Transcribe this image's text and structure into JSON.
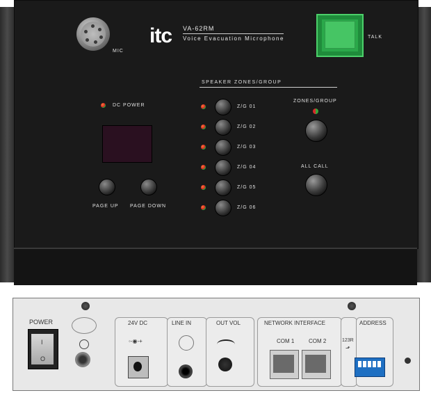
{
  "front": {
    "brand": "itc",
    "model": "VA-62RM",
    "description": "Voice Evacuation Microphone",
    "mic_label": "MIC",
    "talk_label": "TALK",
    "speaker_zones_title": "SPEAKER ZONES/GROUP",
    "power_label": "DC POWER",
    "page_up_label": "PAGE UP",
    "page_down_label": "PAGE DOWN",
    "zones": [
      "Z/G 01",
      "Z/G 02",
      "Z/G 03",
      "Z/G 04",
      "Z/G 05",
      "Z/G 06"
    ],
    "zones_group_label": "ZONES/GROUP",
    "all_call_label": "ALL CALL"
  },
  "back": {
    "power_label": "POWER",
    "power_on": "I",
    "power_off": "O",
    "dc_label": "24V DC",
    "line_in_label": "LINE IN",
    "out_vol_label": "OUT VOL",
    "network_label": "NETWORK INTERFACE",
    "com1_label": "COM 1",
    "com2_label": "COM 2",
    "dip_label": "123R",
    "address_label": "ADDRESS"
  },
  "colors": {
    "talk_green": "#2aa84a",
    "led_red": "#d82a2a",
    "led_green": "#3aa53a",
    "dip_blue": "#1e6fc2"
  }
}
